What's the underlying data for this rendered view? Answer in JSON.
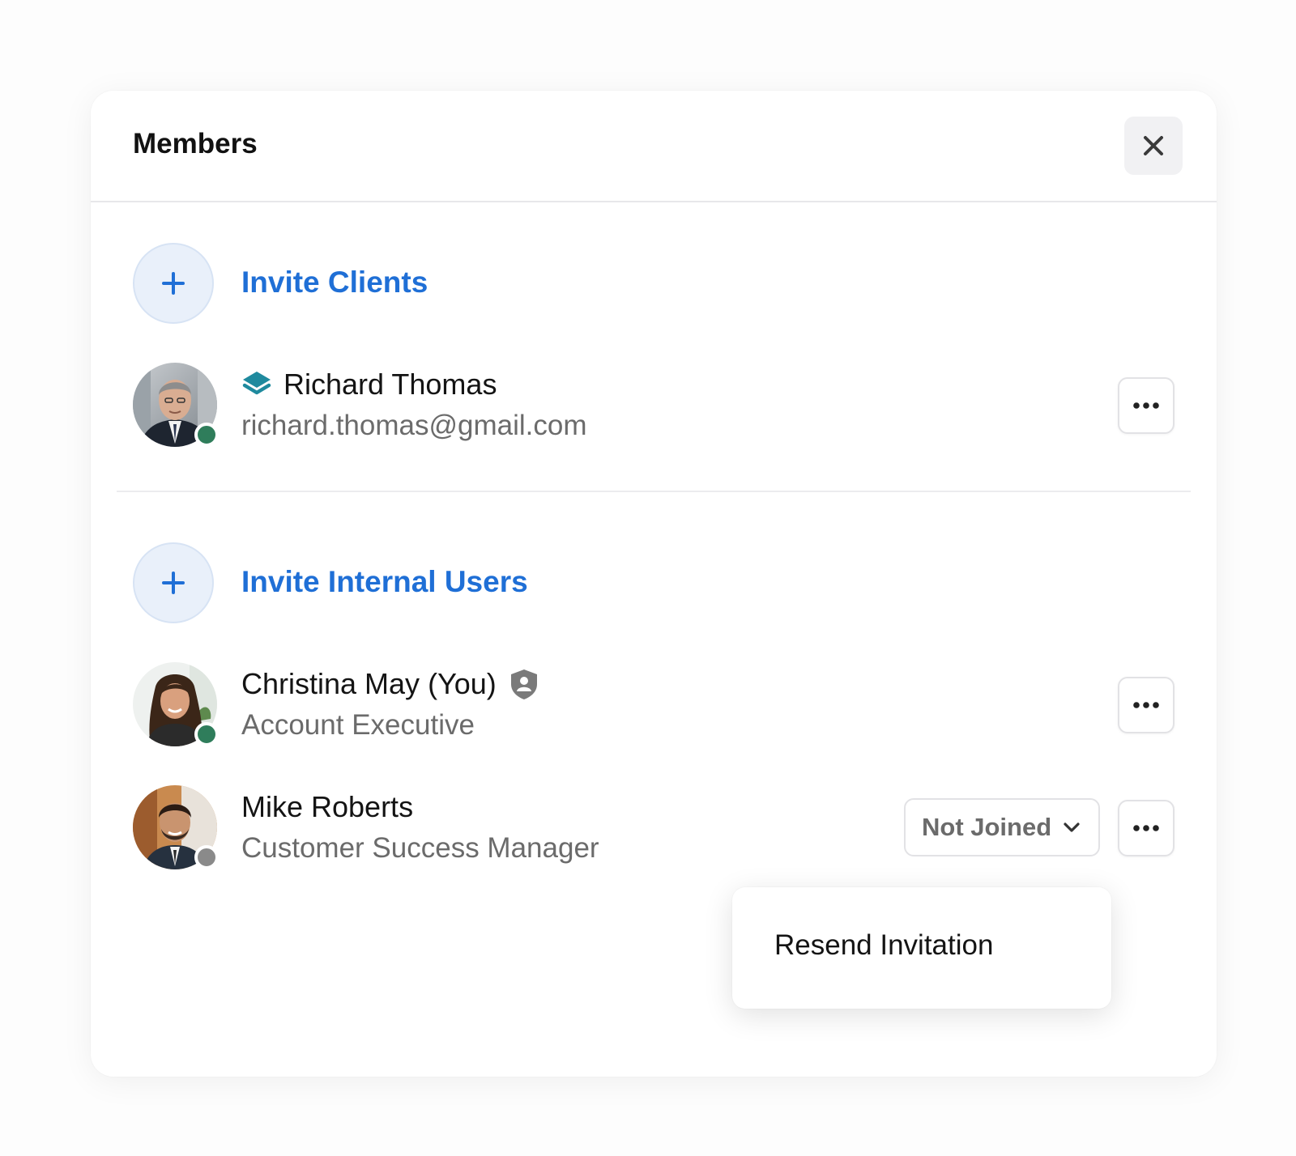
{
  "modal": {
    "title": "Members",
    "close_icon": "close-icon"
  },
  "clients": {
    "invite_label": "Invite Clients",
    "invite_icon": "plus-icon",
    "members": [
      {
        "name": "Richard Thomas",
        "subtitle": "richard.thomas@gmail.com",
        "badge_icon": "layers-icon",
        "status": "online",
        "status_color": "#2f7d5b"
      }
    ]
  },
  "internal": {
    "invite_label": "Invite Internal Users",
    "invite_icon": "plus-icon",
    "members": [
      {
        "name": "Christina May (You)",
        "subtitle": "Account Executive",
        "badge_icon": "shield-user-icon",
        "status": "online",
        "status_color": "#2f7d5b"
      },
      {
        "name": "Mike Roberts",
        "subtitle": "Customer Success Manager",
        "status": "offline",
        "status_color": "#8a8a8a",
        "invite_status": "Not Joined"
      }
    ]
  },
  "menu": {
    "items": [
      "Resend Invitation"
    ]
  },
  "colors": {
    "accent": "#1f6fd6",
    "online": "#2f7d5b",
    "offline": "#8a8a8a",
    "client_badge": "#1f8a9e"
  }
}
